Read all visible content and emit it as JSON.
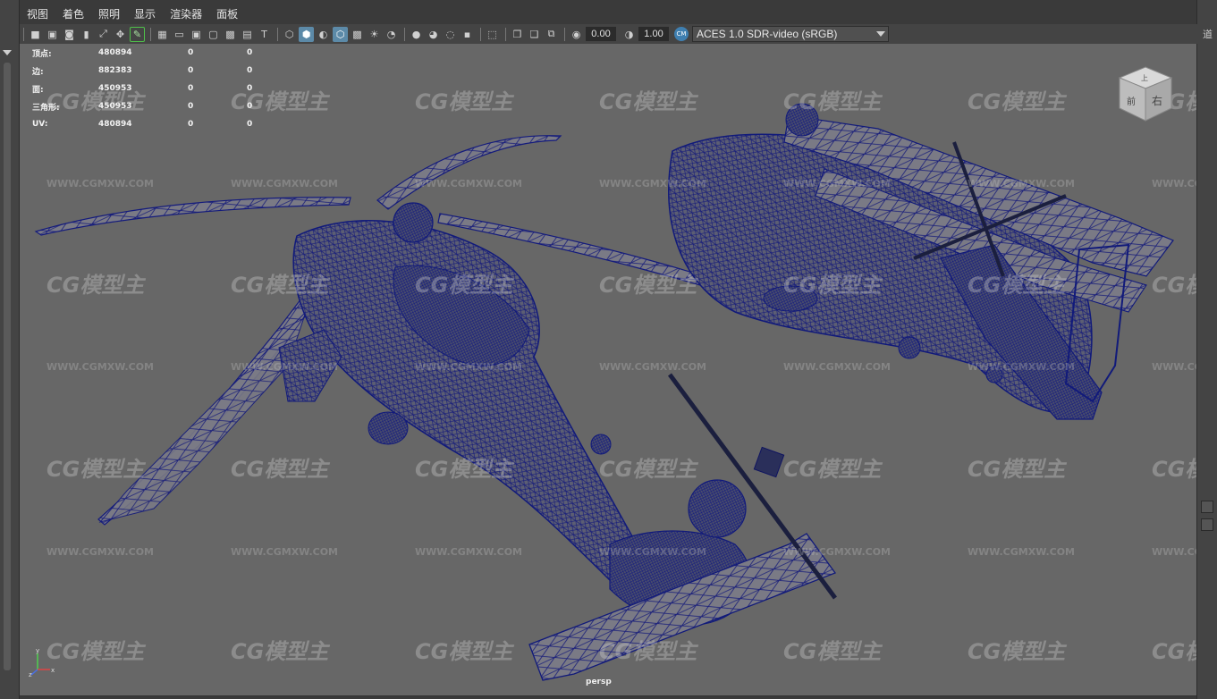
{
  "menu": {
    "items": [
      "视图",
      "着色",
      "照明",
      "显示",
      "渲染器",
      "面板"
    ]
  },
  "toolbar": {
    "exposure_value": "0.00",
    "gamma_value": "1.00",
    "color_space": "ACES 1.0 SDR-video (sRGB)"
  },
  "hud": {
    "rows": [
      {
        "label": "顶点:",
        "v1": "480894",
        "v2": "0",
        "v3": "0"
      },
      {
        "label": "边:",
        "v1": "882383",
        "v2": "0",
        "v3": "0"
      },
      {
        "label": "面:",
        "v1": "450953",
        "v2": "0",
        "v3": "0"
      },
      {
        "label": "三角形:",
        "v1": "450953",
        "v2": "0",
        "v3": "0"
      },
      {
        "label": "UV:",
        "v1": "480894",
        "v2": "0",
        "v3": "0"
      }
    ]
  },
  "viewcube": {
    "front": "前",
    "right": "右",
    "top": "上"
  },
  "viewport": {
    "camera": "persp"
  },
  "watermark": {
    "logo": "CG模型主",
    "url": "WWW.CGMXW.COM"
  },
  "right_dock": {
    "glyph": "道"
  },
  "colors": {
    "wireframe": "#101a70",
    "viewport_bg": "#676767"
  }
}
